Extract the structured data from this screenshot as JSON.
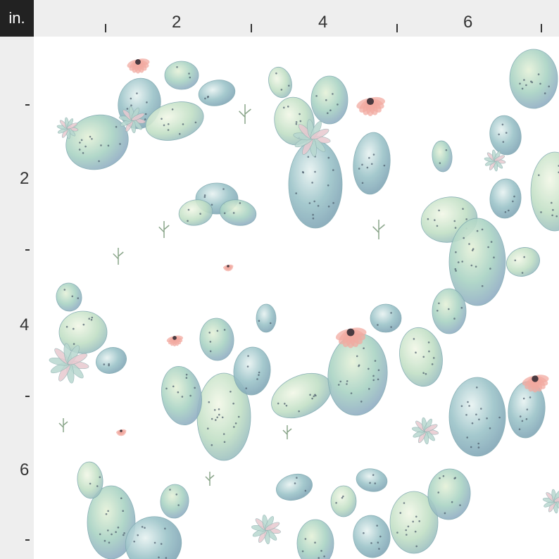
{
  "ruler": {
    "unit": "in.",
    "top_labels": [
      "2",
      "4",
      "6"
    ],
    "left_labels": [
      "2",
      "4",
      "6"
    ]
  },
  "palette": {
    "pad_green": "#a9d3c4",
    "pad_blue": "#9cc4c9",
    "pad_mint": "#c2e0c6",
    "pad_shadow": "#8ea9c4",
    "flower_pink": "#f2a9a0",
    "succulent": "#b8d8d0",
    "spine": "#4a5a6a"
  },
  "pattern": {
    "motif_icons": [
      "prickly-pear-cactus-icon",
      "cactus-flower-icon",
      "succulent-rosette-icon",
      "sprig-icon"
    ]
  }
}
